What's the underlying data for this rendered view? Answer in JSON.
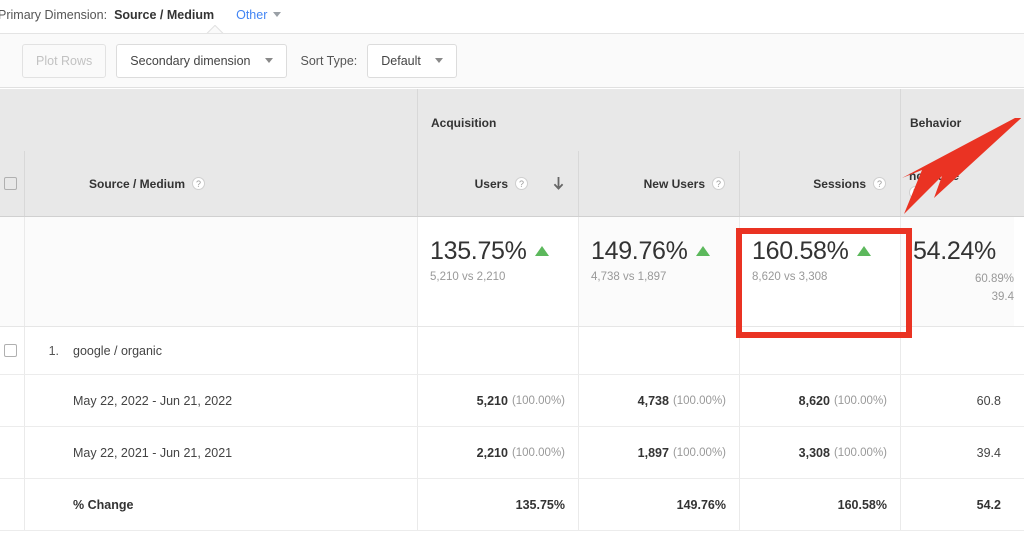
{
  "primary_dimension": {
    "label": "Primary Dimension:",
    "value": "Source / Medium",
    "other_link": "Other"
  },
  "toolbar": {
    "plot_rows_label": "Plot Rows",
    "secondary_dimension_label": "Secondary dimension",
    "sort_type_label": "Sort Type:",
    "sort_type_value": "Default"
  },
  "table": {
    "group_headers": [
      {
        "label": "Acquisition"
      },
      {
        "label": "Behavior"
      }
    ],
    "dimension_header": "Source / Medium",
    "help_icon": "?",
    "metric_headers": [
      {
        "label": "Users",
        "sorted": true
      },
      {
        "label": "New Users",
        "sorted": false
      },
      {
        "label": "Sessions",
        "sorted": false
      },
      {
        "label": "nce Rate",
        "sorted": false
      }
    ],
    "summary": [
      {
        "pct": "135.75%",
        "detail": "5,210 vs 2,210",
        "trend": "up"
      },
      {
        "pct": "149.76%",
        "detail": "4,738 vs 1,897",
        "trend": "up"
      },
      {
        "pct": "160.58%",
        "detail": "8,620 vs 3,308",
        "trend": "up"
      },
      {
        "pct": "54.24%",
        "detail_1": "60.89%",
        "detail_2": "39.4",
        "trend": "none"
      }
    ],
    "row_index": "1.",
    "row_name": "google / organic",
    "periods": [
      {
        "label": "May 22, 2022 - Jun 21, 2022",
        "users": "5,210",
        "users_pct": "(100.00%)",
        "new_users": "4,738",
        "new_users_pct": "(100.00%)",
        "sessions": "8,620",
        "sessions_pct": "(100.00%)",
        "bounce": "60.8"
      },
      {
        "label": "May 22, 2021 - Jun 21, 2021",
        "users": "2,210",
        "users_pct": "(100.00%)",
        "new_users": "1,897",
        "new_users_pct": "(100.00%)",
        "sessions": "3,308",
        "sessions_pct": "(100.00%)",
        "bounce": "39.4"
      }
    ],
    "change_row": {
      "label": "% Change",
      "users": "135.75%",
      "new_users": "149.76%",
      "sessions": "160.58%",
      "bounce": "54.2"
    }
  },
  "annotations": {
    "highlight_color": "#ea3323",
    "trend_up_color": "#5cb85c",
    "link_color": "#4285f4"
  }
}
